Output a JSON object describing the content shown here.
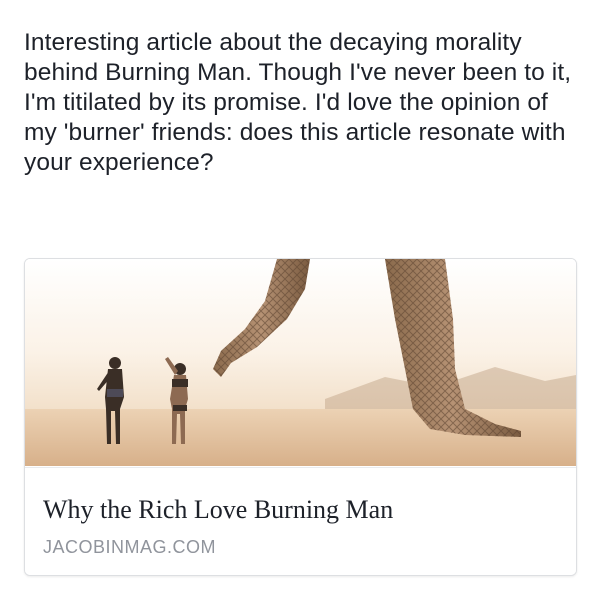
{
  "post": {
    "text": "Interesting article about the decaying morality behind Burning Man. Though I've never been to it, I'm titilated by its promise. I'd love the opinion of my 'burner' friends: does this article resonate with your experience?"
  },
  "link_preview": {
    "title": "Why the Rich Love Burning Man",
    "domain": "JACOBINMAG.COM",
    "image_subject": "giant-lattice-sculpture-legs-in-desert"
  },
  "colors": {
    "text": "#1d2129",
    "domain": "#90949c",
    "card_border": "#dddfe2"
  }
}
